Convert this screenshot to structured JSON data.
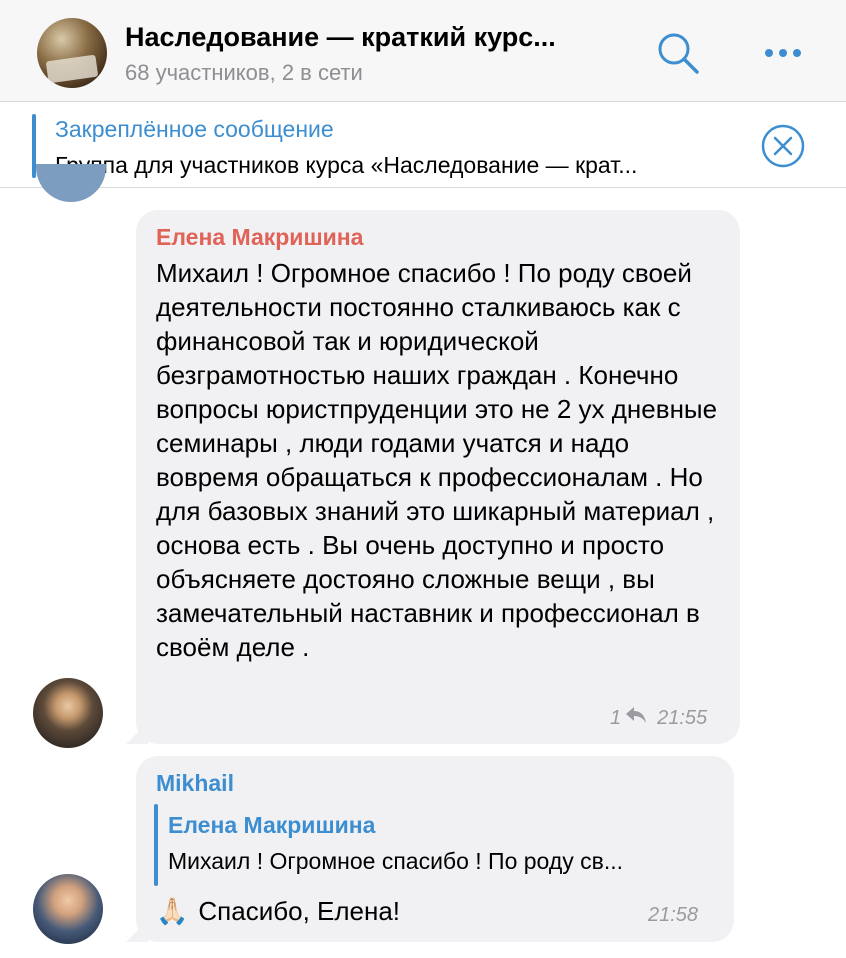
{
  "header": {
    "title": "Наследование — краткий курс...",
    "subtitle": "68 участников, 2 в сети",
    "search_icon": "search-icon",
    "more_icon": "more-dots-icon",
    "accent": "#3d8ed0"
  },
  "pinned": {
    "title": "Закреплённое сообщение",
    "text": "Группа для участников курса «Наследование — крат..."
  },
  "messages": [
    {
      "author": "Елена Макришина",
      "author_color": "#e06357",
      "text": "Михаил ! Огромное спасибо ! По роду своей деятельности постоянно сталкиваюсь как с финансовой так и юридической безграмотностью наших граждан . Конечно вопросы юристпруденции это не 2 ух дневные семинары , люди годами учатся и  надо вовремя обращаться к профессионалам . Но для базовых знаний это шикарный материал , основа есть .  Вы очень доступно и просто объясняете достояно сложные вещи , вы замечательный наставник и профессионал в своём деле .",
      "replies": "1",
      "time": "21:55"
    },
    {
      "author": "Mikhail",
      "author_color": "#3d8ed0",
      "reply_to_name": "Елена Макришина",
      "reply_to_text": "Михаил ! Огромное спасибо ! По роду св...",
      "emoji": "🙏🏻",
      "text": "Спасибо, Елена!",
      "time": "21:58"
    }
  ]
}
